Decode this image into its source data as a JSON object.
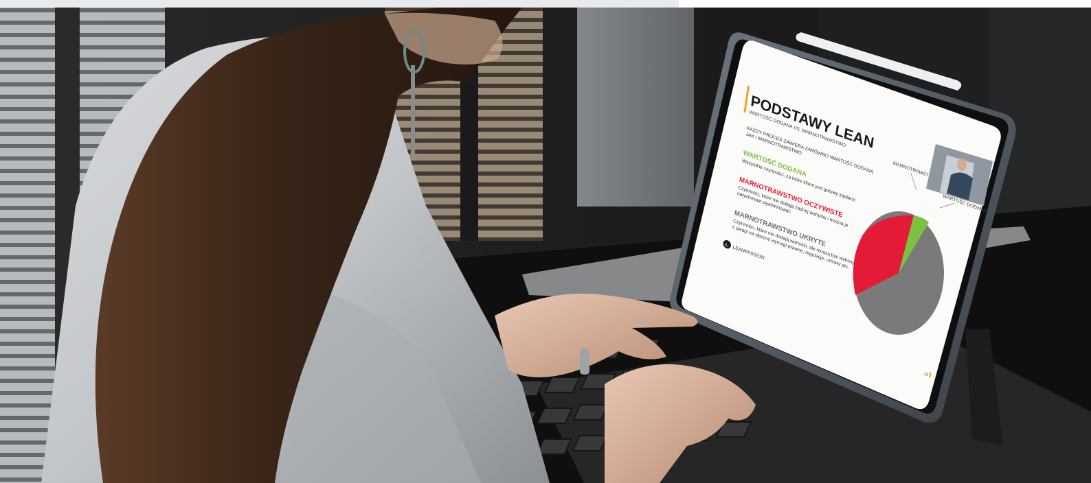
{
  "slide": {
    "title": "PODSTAWY LEAN",
    "subtitle": "WARTOŚĆ DODANA VS. MARNOTRAWSTWO",
    "intro_line1": "KAŻDY PROCES ZAWIERA ZARÓWNO WARTOŚĆ DODANĄ",
    "intro_line2": "JAK I MARNOTRAWSTWO",
    "section1_heading": "WARTOŚĆ DODANA",
    "section1_text": "Wszystkie czynności, za które klient jest gotowy zapłacić",
    "section2_heading": "MARNOTRAWSTWO OCZYWISTE",
    "section2_text1": "Czynności, które nie dodają żadnej wartości i można je",
    "section2_text2": "natychmiast wyeliminować",
    "section3_heading": "MARNOTRAWSTWO UKRYTE",
    "section3_text1": "Czynności, które nie dodają wartości, ale muszą być wykonywane",
    "section3_text2": "z uwagi na obecne wymogi prawne, regulacje, umowy etc.",
    "logo_text": "LEANPASSION",
    "page_number": "15",
    "pie_label_waste": "MARNOTRAWSTWO",
    "pie_label_value": "WARTOŚĆ DODANA"
  },
  "colors": {
    "accent": "#f0a020",
    "green": "#7dc142",
    "red": "#e31b37",
    "grey": "#7a7a7a"
  },
  "icons": {
    "logo": "leanpassion-logo-icon",
    "pen": "stylus-pen"
  }
}
